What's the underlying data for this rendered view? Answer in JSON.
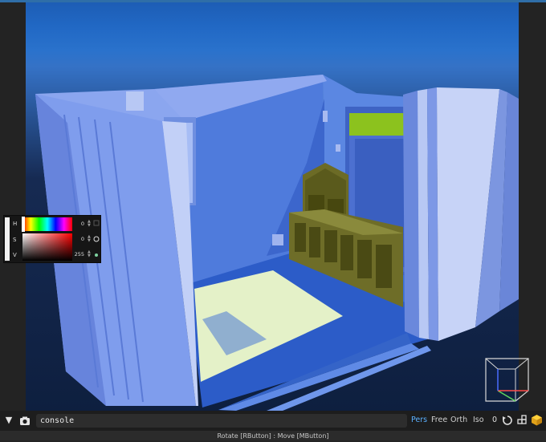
{
  "viewport": {
    "scene": "3D room model"
  },
  "color_picker": {
    "h_label": "H",
    "s_label": "S",
    "v_label": "V",
    "h_value": "0",
    "s_value": "0",
    "v_value": "255"
  },
  "bottom_bar": {
    "menu_icon": "chevron-down-icon",
    "camera_icon": "camera-icon",
    "console_value": "console",
    "modes": [
      "Pers",
      "Free",
      "Orth",
      "Iso"
    ],
    "active_mode": "Pers",
    "counter": "0",
    "icons": [
      "reset-rotate-icon",
      "grid-split-icon",
      "cube-icon"
    ]
  },
  "status_bar": {
    "text": "Rotate [RButton] : Move [MButton]"
  },
  "colors": {
    "accent": "#5bb0ff",
    "sky": "#2a6fcc",
    "floor_blue": "#3d72d8",
    "wall_blue": "#7a96e8",
    "shelf_olive": "#6c6b26",
    "window_green": "#8cc21e"
  }
}
